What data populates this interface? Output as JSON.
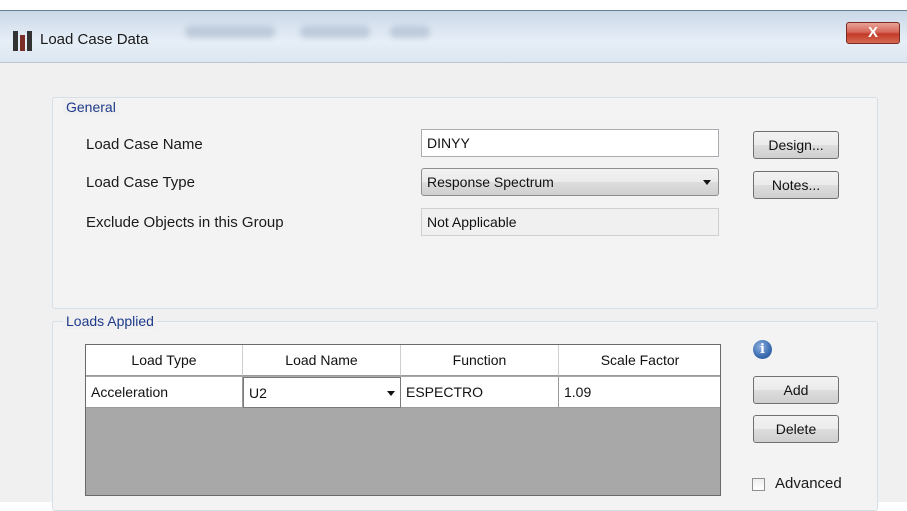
{
  "window": {
    "title": "Load Case Data",
    "close_label": "X"
  },
  "general": {
    "group_label": "General",
    "load_case_name_label": "Load Case Name",
    "load_case_name_value": "DINYY",
    "load_case_type_label": "Load Case Type",
    "load_case_type_value": "Response Spectrum",
    "exclude_label": "Exclude Objects in this Group",
    "exclude_value": "Not Applicable",
    "design_button": "Design...",
    "notes_button": "Notes..."
  },
  "loads_applied": {
    "group_label": "Loads Applied",
    "columns": [
      "Load Type",
      "Load Name",
      "Function",
      "Scale Factor"
    ],
    "rows": [
      {
        "load_type": "Acceleration",
        "load_name": "U2",
        "function": "ESPECTRO",
        "scale_factor": "1.09"
      }
    ],
    "add_button": "Add",
    "delete_button": "Delete",
    "advanced_label": "Advanced",
    "advanced_checked": false
  },
  "icons": {
    "app": "app-icon",
    "info": "info-icon",
    "close": "close-icon"
  },
  "colors": {
    "group_label": "#1e3a8a",
    "close_button": "#c23a2a",
    "grid_empty": "#a8a8a8"
  }
}
